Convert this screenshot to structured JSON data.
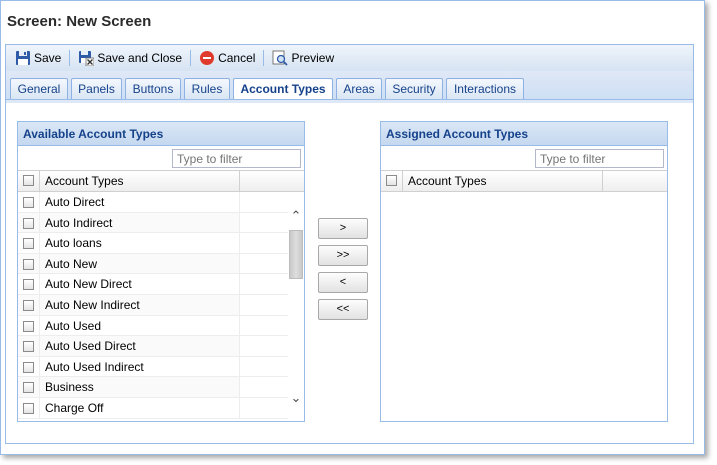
{
  "window": {
    "title": "Screen: New Screen"
  },
  "toolbar": {
    "save": "Save",
    "save_close": "Save and Close",
    "cancel": "Cancel",
    "preview": "Preview"
  },
  "tabs": [
    "General",
    "Panels",
    "Buttons",
    "Rules",
    "Account Types",
    "Areas",
    "Security",
    "Interactions"
  ],
  "active_tab": "Account Types",
  "available": {
    "title": "Available Account Types",
    "filter_placeholder": "Type to filter",
    "column": "Account Types",
    "items": [
      "Auto Direct",
      "Auto Indirect",
      "Auto loans",
      "Auto New",
      "Auto New Direct",
      "Auto New Indirect",
      "Auto Used",
      "Auto Used Direct",
      "Auto Used Indirect",
      "Business",
      "Charge Off"
    ]
  },
  "assigned": {
    "title": "Assigned Account Types",
    "filter_placeholder": "Type to filter",
    "column": "Account Types",
    "items": []
  },
  "move_buttons": {
    "add": ">",
    "add_all": ">>",
    "remove": "<",
    "remove_all": "<<"
  },
  "colors": {
    "accent": "#15428b",
    "border": "#99bbe8"
  },
  "icons": {
    "save": "floppy-disk-icon",
    "save_close": "floppy-disk-close-icon",
    "cancel": "cancel-circle-icon",
    "preview": "preview-magnifier-icon"
  }
}
